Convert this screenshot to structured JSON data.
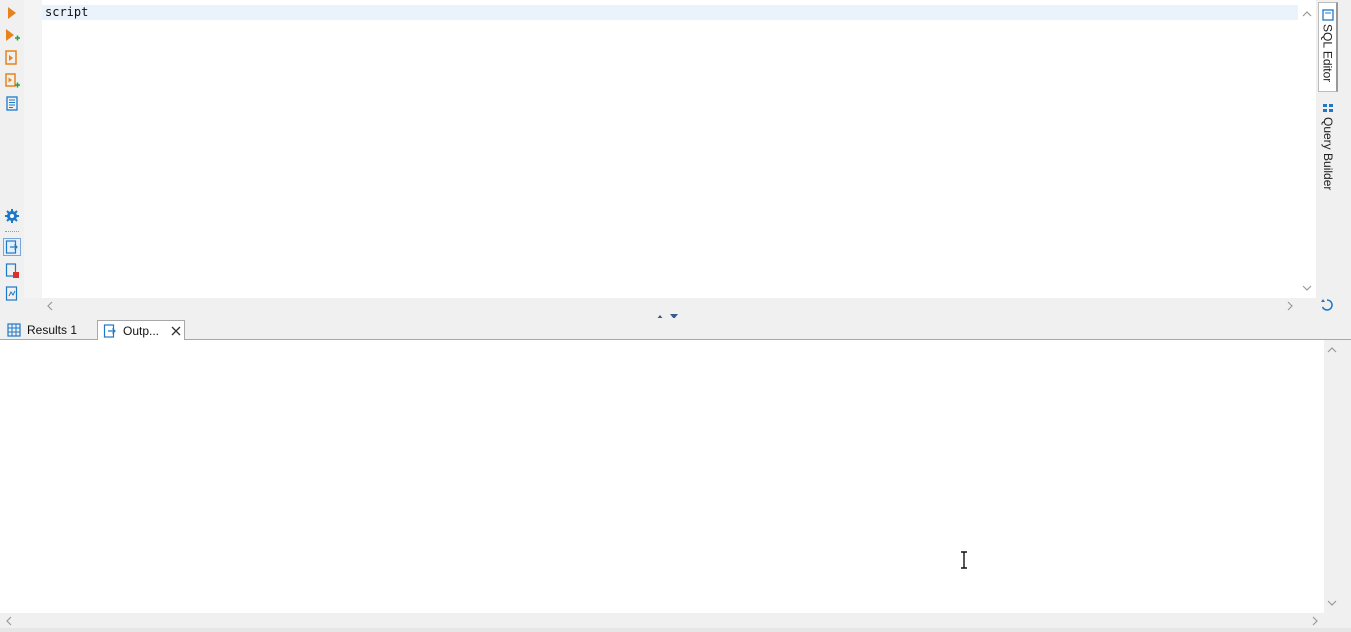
{
  "editor": {
    "lines": [
      "script"
    ]
  },
  "right_tabs": {
    "sql_editor": "SQL Editor",
    "query_builder": "Query Builder"
  },
  "bottom_tabs": {
    "results": "Results 1",
    "output": "Outp..."
  },
  "colors": {
    "accent_orange": "#e8821e",
    "accent_blue": "#1e78c8",
    "active_line": "#eaf2fb"
  },
  "icons": {
    "execute": "play-icon",
    "execute_current": "play-add-icon",
    "execute_script": "script-run-icon",
    "execute_script_from_cursor": "script-run-add-icon",
    "explain": "document-list-icon",
    "settings": "gear-icon",
    "export": "export-icon",
    "stop": "stop-document-icon",
    "log": "log-document-icon",
    "restore_layout": "restore-icon"
  }
}
